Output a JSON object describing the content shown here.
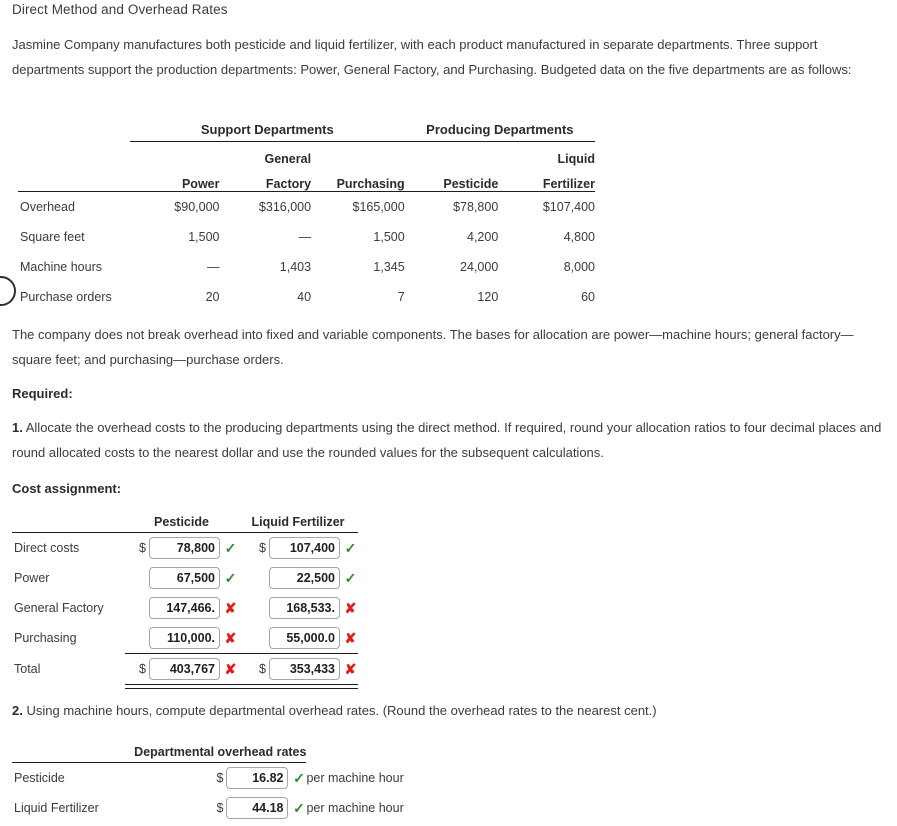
{
  "title": "Direct Method and Overhead Rates",
  "intro": "Jasmine Company manufactures both pesticide and liquid fertilizer, with each product manufactured in separate departments. Three support departments support the production departments: Power, General Factory, and Purchasing. Budgeted data on the five departments are as follows:",
  "budget_table": {
    "group_headers": [
      "Support Departments",
      "Producing Departments"
    ],
    "columns": [
      {
        "line1": "",
        "line2": "Power"
      },
      {
        "line1": "General",
        "line2": "Factory"
      },
      {
        "line1": "",
        "line2": "Purchasing"
      },
      {
        "line1": "",
        "line2": "Pesticide"
      },
      {
        "line1": "Liquid",
        "line2": "Fertilizer"
      }
    ],
    "rows": [
      {
        "label": "Overhead",
        "values": [
          "$90,000",
          "$316,000",
          "$165,000",
          "$78,800",
          "$107,400"
        ]
      },
      {
        "label": "Square feet",
        "values": [
          "1,500",
          "—",
          "1,500",
          "4,200",
          "4,800"
        ]
      },
      {
        "label": "Machine hours",
        "values": [
          "—",
          "1,403",
          "1,345",
          "24,000",
          "8,000"
        ]
      },
      {
        "label": "Purchase orders",
        "values": [
          "20",
          "40",
          "7",
          "120",
          "60"
        ]
      }
    ]
  },
  "note": "The company does not break overhead into fixed and variable components. The bases for allocation are power—machine hours; general factory—square feet; and purchasing—purchase orders.",
  "required_label": "Required:",
  "question1_number": "1.",
  "question1": "Allocate the overhead costs to the producing departments using the direct method. If required, round your allocation ratios to four decimal places and round allocated costs to the nearest dollar and use the rounded values for the subsequent calculations.",
  "cost_assignment_label": "Cost assignment:",
  "cost_table": {
    "columns": [
      "Pesticide",
      "Liquid Fertilizer"
    ],
    "rows": [
      {
        "label": "Direct costs",
        "pesticide": {
          "prefix": "$",
          "value": "78,800",
          "mark": "✓",
          "status": "ok"
        },
        "fertilizer": {
          "prefix": "$",
          "value": "107,400",
          "mark": "✓",
          "status": "ok"
        }
      },
      {
        "label": "Power",
        "pesticide": {
          "prefix": "",
          "value": "67,500",
          "mark": "✓",
          "status": "ok"
        },
        "fertilizer": {
          "prefix": "",
          "value": "22,500",
          "mark": "✓",
          "status": "ok"
        }
      },
      {
        "label": "General Factory",
        "pesticide": {
          "prefix": "",
          "value": "147,466.",
          "mark": "✘",
          "status": "bad"
        },
        "fertilizer": {
          "prefix": "",
          "value": "168,533.",
          "mark": "✘",
          "status": "bad"
        }
      },
      {
        "label": "Purchasing",
        "pesticide": {
          "prefix": "",
          "value": "110,000.",
          "mark": "✘",
          "status": "bad"
        },
        "fertilizer": {
          "prefix": "",
          "value": "55,000.0",
          "mark": "✘",
          "status": "bad"
        }
      }
    ],
    "total": {
      "label": "Total",
      "pesticide": {
        "prefix": "$",
        "value": "403,767",
        "mark": "✘",
        "status": "bad"
      },
      "fertilizer": {
        "prefix": "$",
        "value": "353,433",
        "mark": "✘",
        "status": "bad"
      }
    }
  },
  "question2_number": "2.",
  "question2": "Using machine hours, compute departmental overhead rates. (Round the overhead rates to the nearest cent.)",
  "rates_table": {
    "header": "Departmental overhead rates",
    "rows": [
      {
        "label": "Pesticide",
        "prefix": "$",
        "value": "16.82",
        "mark": "✓",
        "status": "ok",
        "unit": "per machine hour"
      },
      {
        "label": "Liquid Fertilizer",
        "prefix": "$",
        "value": "44.18",
        "mark": "✓",
        "status": "ok",
        "unit": "per machine hour"
      }
    ]
  },
  "colors": {
    "correct": "#2e8b2e",
    "incorrect": "#e31b1b",
    "text": "#3b3b3b",
    "rule": "#1d1d1d"
  }
}
